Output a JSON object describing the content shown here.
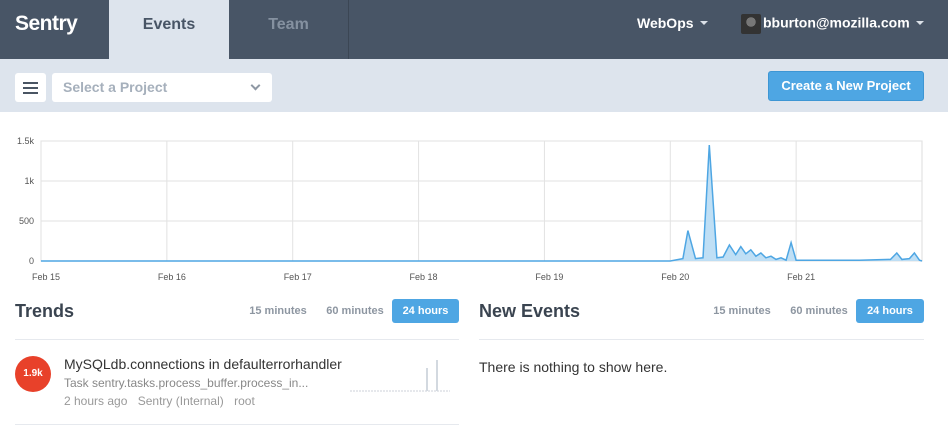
{
  "nav": {
    "logo": "Sentry",
    "tabs": [
      {
        "label": "Events",
        "active": true
      },
      {
        "label": "Team",
        "active": false
      }
    ],
    "org": "WebOps",
    "user": "bburton@mozilla.com"
  },
  "toolbar": {
    "project_placeholder": "Select a Project",
    "create_label": "Create a New Project"
  },
  "colors": {
    "nav_bg": "#485566",
    "accent": "#4ea6e3",
    "badge": "#e8412a"
  },
  "chart_data": {
    "type": "area",
    "categories": [
      "Feb 15",
      "Feb 16",
      "Feb 17",
      "Feb 18",
      "Feb 19",
      "Feb 20",
      "Feb 21"
    ],
    "yticks": [
      0,
      500,
      1000,
      1500
    ],
    "ytick_labels": [
      "0",
      "500",
      "1k",
      "1.5k"
    ],
    "ylim": [
      0,
      1500
    ],
    "xlim": [
      0,
      7.0
    ],
    "grid": true,
    "series": [
      {
        "points": [
          [
            0,
            0
          ],
          [
            5.0,
            0
          ],
          [
            5.1,
            30
          ],
          [
            5.14,
            380
          ],
          [
            5.2,
            30
          ],
          [
            5.26,
            40
          ],
          [
            5.31,
            1450
          ],
          [
            5.37,
            40
          ],
          [
            5.42,
            50
          ],
          [
            5.47,
            200
          ],
          [
            5.52,
            80
          ],
          [
            5.56,
            180
          ],
          [
            5.6,
            90
          ],
          [
            5.64,
            140
          ],
          [
            5.68,
            60
          ],
          [
            5.72,
            100
          ],
          [
            5.76,
            40
          ],
          [
            5.8,
            60
          ],
          [
            5.84,
            20
          ],
          [
            5.88,
            40
          ],
          [
            5.92,
            10
          ],
          [
            5.96,
            230
          ],
          [
            6.0,
            10
          ],
          [
            6.1,
            10
          ],
          [
            6.5,
            10
          ],
          [
            6.75,
            20
          ],
          [
            6.8,
            100
          ],
          [
            6.84,
            20
          ],
          [
            6.9,
            30
          ],
          [
            6.94,
            100
          ],
          [
            6.98,
            10
          ],
          [
            7.0,
            0
          ]
        ]
      }
    ]
  },
  "trends": {
    "title": "Trends",
    "tabs": [
      "15 minutes",
      "60 minutes",
      "24 hours"
    ],
    "active_tab": "24 hours",
    "items": [
      {
        "count": "1.9k",
        "title": "MySQLdb.connections in defaulterrorhandler",
        "subtitle": "Task sentry.tasks.process_buffer.process_in...",
        "time": "2 hours ago",
        "project": "Sentry (Internal)",
        "logger": "root",
        "spark": [
          0,
          0,
          0,
          0,
          0,
          0,
          0,
          0,
          0,
          0,
          0,
          0,
          0,
          0,
          0,
          0,
          0,
          0,
          0,
          0,
          0,
          0,
          0,
          0,
          0,
          0,
          0,
          0,
          0,
          0,
          0,
          0,
          0,
          0,
          0,
          0,
          0,
          0,
          0,
          0,
          0,
          0,
          0,
          0,
          0,
          0,
          0,
          0,
          0,
          0,
          0,
          0,
          0,
          0,
          0,
          0,
          0,
          0,
          0,
          0,
          0,
          0,
          0,
          0,
          0,
          0,
          0,
          0,
          0,
          0,
          0,
          0,
          0,
          0,
          0,
          0,
          0,
          1,
          0,
          0,
          0,
          0,
          0,
          0,
          0,
          0,
          0,
          0,
          0,
          0,
          0,
          0,
          0,
          0,
          0,
          0,
          0,
          0,
          0,
          0,
          0,
          0,
          0,
          0,
          0,
          0,
          0,
          0,
          0,
          0,
          0,
          0,
          0,
          0,
          0
        ]
      }
    ]
  },
  "new_events": {
    "title": "New Events",
    "tabs": [
      "15 minutes",
      "60 minutes",
      "24 hours"
    ],
    "active_tab": "24 hours",
    "empty_text": "There is nothing to show here."
  }
}
